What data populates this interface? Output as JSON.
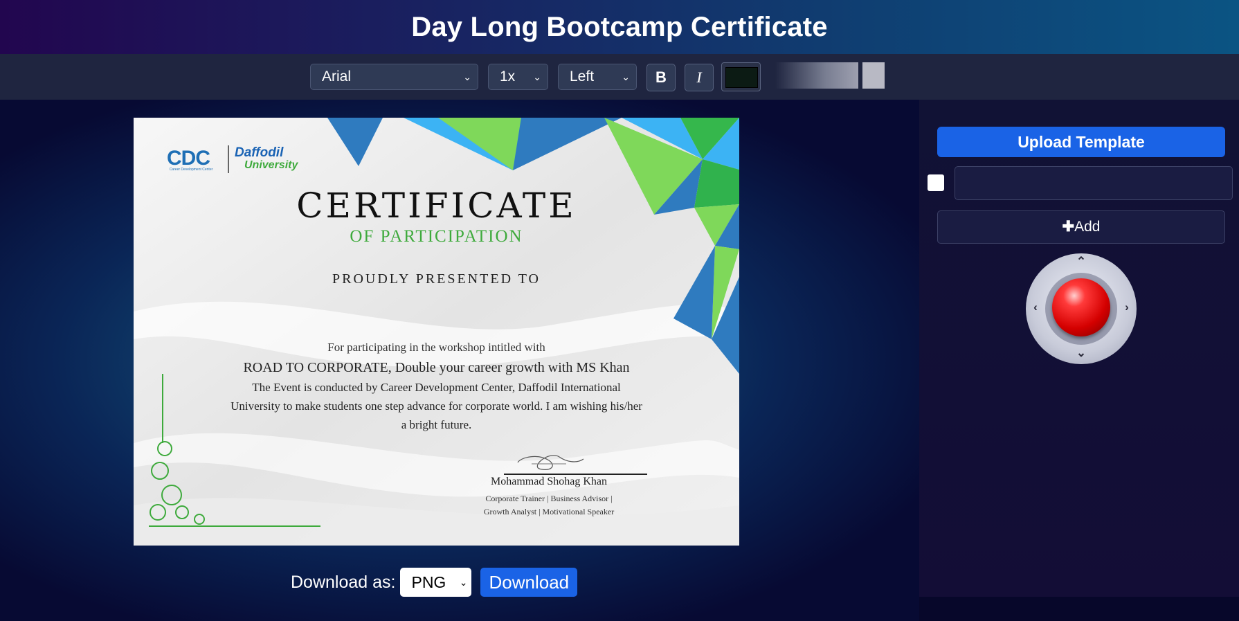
{
  "header": {
    "title": "Day Long Bootcamp Certificate"
  },
  "toolbar": {
    "font_family": "Arial",
    "font_size": "1x",
    "alignment": "Left",
    "bold_label": "B",
    "italic_label": "I",
    "text_color": "#0c1b14"
  },
  "certificate": {
    "logo_cdc": "CDC",
    "logo_cdc_sub": "Career Development Center",
    "logo_university_line1": "Daffodil",
    "logo_university_line2": "University",
    "title": "CERTIFICATE",
    "subtitle": "OF PARTICIPATION",
    "presented": "PROUDLY PRESENTED TO",
    "intro": "For participating in the workshop intitled with",
    "workshop": "ROAD TO CORPORATE, Double your career growth with MS Khan",
    "body_line1": "The Event is conducted by Career Development Center, Daffodil International",
    "body_line2": "University to make students one step advance for corporate world. I am wishing his/her",
    "body_line3": "a bright future.",
    "signer_name": "Mohammad Shohag Khan",
    "signer_role1": "Corporate Trainer | Business Advisor |",
    "signer_role2": "Growth Analyst | Motivational Speaker",
    "accent_green": "#3eaa3c",
    "accent_blue": "#2f7bbf"
  },
  "download": {
    "label": "Download as:",
    "format": "PNG",
    "button": "Download"
  },
  "sidebar": {
    "upload_label": "Upload Template",
    "text_input_value": "",
    "add_label": "Add",
    "add_icon": "plus-icon"
  }
}
